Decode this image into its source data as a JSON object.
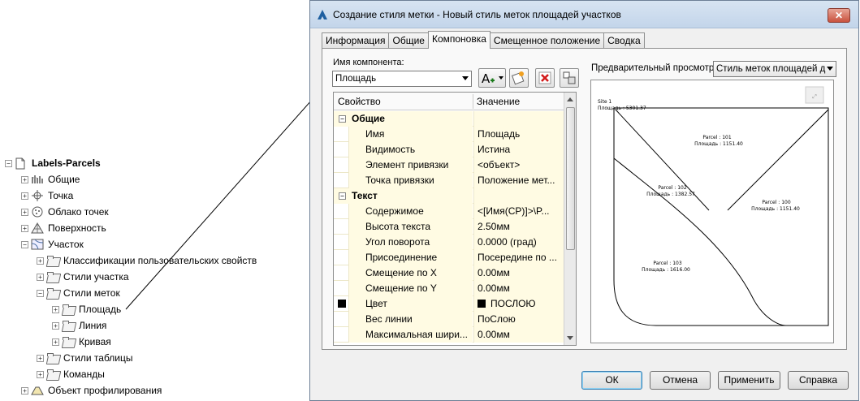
{
  "tree": {
    "root": "Labels-Parcels",
    "items": [
      {
        "label": "Общие",
        "icon": "general-settings-icon"
      },
      {
        "label": "Точка",
        "icon": "point-icon"
      },
      {
        "label": "Облако точек",
        "icon": "point-cloud-icon"
      },
      {
        "label": "Поверхность",
        "icon": "surface-icon"
      },
      {
        "label": "Участок",
        "icon": "site-icon"
      },
      {
        "label": "Классификации пользовательских свойств",
        "icon": "folder-icon"
      },
      {
        "label": "Стили участка",
        "icon": "folder-icon"
      },
      {
        "label": "Стили меток",
        "icon": "folder-icon"
      },
      {
        "label": "Площадь",
        "icon": "folder-icon"
      },
      {
        "label": "Линия",
        "icon": "folder-icon"
      },
      {
        "label": "Кривая",
        "icon": "folder-icon"
      },
      {
        "label": "Стили таблицы",
        "icon": "folder-icon"
      },
      {
        "label": "Команды",
        "icon": "folder-icon"
      },
      {
        "label": "Объект профилирования",
        "icon": "grading-icon"
      }
    ]
  },
  "dialog": {
    "title": "Создание стиля метки - Новый стиль меток площадей участков",
    "close": "✕",
    "tabs": [
      "Информация",
      "Общие",
      "Компоновка",
      "Смещенное положение",
      "Сводка"
    ],
    "active_tab": "Компоновка",
    "component_name_label": "Имя компонента:",
    "component_name_value": "Площадь",
    "grid": {
      "col_property": "Свойство",
      "col_value": "Значение",
      "sections": [
        {
          "name": "Общие",
          "rows": [
            {
              "name": "Имя",
              "value": "Площадь"
            },
            {
              "name": "Видимость",
              "value": "Истина"
            },
            {
              "name": "Элемент привязки",
              "value": "<объект>"
            },
            {
              "name": "Точка привязки",
              "value": "Положение мет..."
            }
          ]
        },
        {
          "name": "Текст",
          "rows": [
            {
              "name": "Содержимое",
              "value": "<[Имя(CP)]>\\P..."
            },
            {
              "name": "Высота текста",
              "value": "2.50мм"
            },
            {
              "name": "Угол поворота",
              "value": "0.0000 (град)"
            },
            {
              "name": "Присоединение",
              "value": "Посередине по ..."
            },
            {
              "name": "Смещение по X",
              "value": "0.00мм"
            },
            {
              "name": "Смещение по Y",
              "value": "0.00мм"
            },
            {
              "name": "Цвет",
              "value": "ПОСЛОЮ"
            },
            {
              "name": "Вес линии",
              "value": "ПоСлою"
            },
            {
              "name": "Максимальная шири...",
              "value": "0.00мм"
            }
          ]
        }
      ]
    },
    "preview_label": "Предварительный просмотр",
    "preview_style": "Стиль меток площадей д",
    "preview": {
      "site_label": "Site 1",
      "site_area": "Площадь : 5301.37",
      "parcels": [
        {
          "name": "Parcel : 101",
          "area": "Площадь : 1151.40"
        },
        {
          "name": "Parcel : 102",
          "area": "Площадь : 1382.57"
        },
        {
          "name": "Parcel : 100",
          "area": "Площадь : 1151.40"
        },
        {
          "name": "Parcel : 103",
          "area": "Площадь : 1616.00"
        }
      ]
    },
    "buttons": {
      "ok": "ОК",
      "cancel": "Отмена",
      "apply": "Применить",
      "help": "Справка"
    }
  }
}
